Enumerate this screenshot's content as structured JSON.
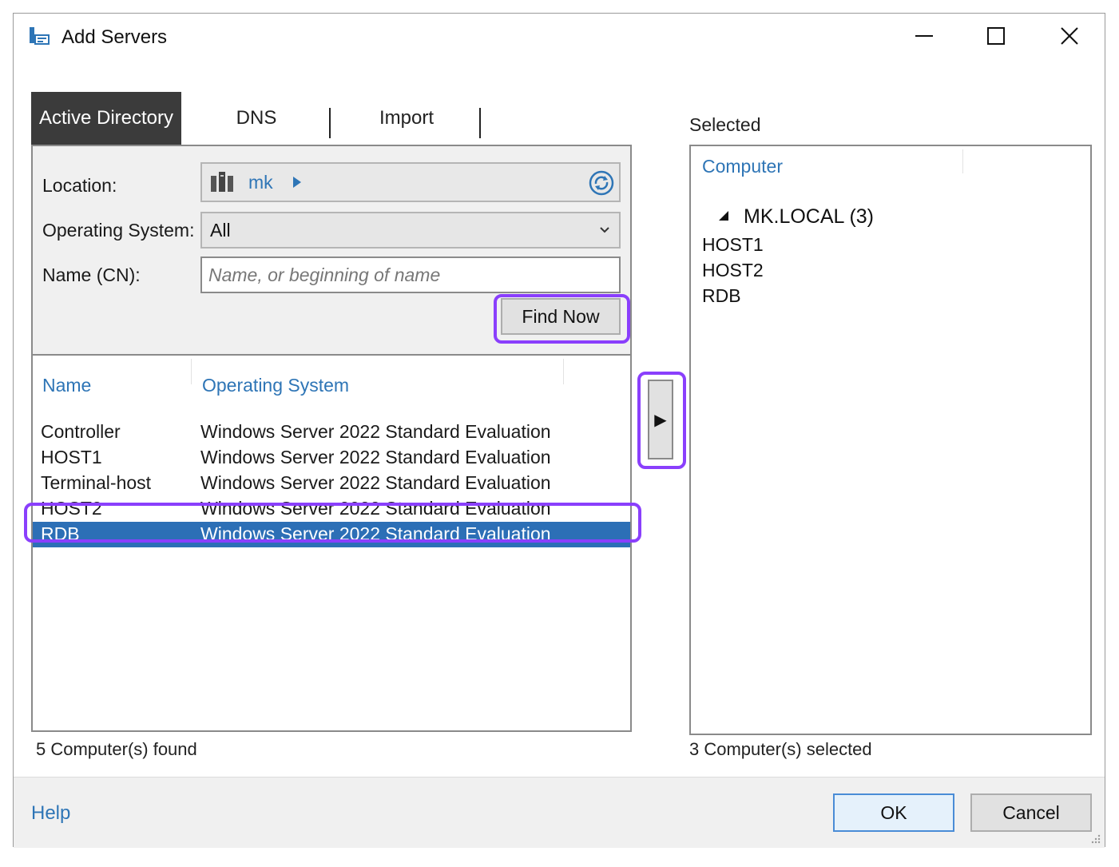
{
  "window": {
    "title": "Add Servers",
    "controls": {
      "minimize": "minimize",
      "maximize": "maximize",
      "close": "close"
    }
  },
  "tabs": [
    {
      "label": "Active Directory",
      "active": true
    },
    {
      "label": "DNS",
      "active": false
    },
    {
      "label": "Import",
      "active": false
    }
  ],
  "search": {
    "location_label": "Location:",
    "location_value": "mk",
    "os_label": "Operating System:",
    "os_value": "All",
    "name_label": "Name (CN):",
    "name_placeholder": "Name, or beginning of name",
    "name_value": "",
    "find_now_label": "Find Now"
  },
  "results": {
    "columns": [
      "Name",
      "Operating System"
    ],
    "rows": [
      {
        "name": "Controller",
        "os": "Windows Server 2022 Standard Evaluation",
        "selected": false
      },
      {
        "name": "HOST1",
        "os": "Windows Server 2022 Standard Evaluation",
        "selected": false
      },
      {
        "name": "Terminal-host",
        "os": "Windows Server 2022 Standard Evaluation",
        "selected": false
      },
      {
        "name": "HOST2",
        "os": "Windows Server 2022 Standard Evaluation",
        "selected": false
      },
      {
        "name": "RDB",
        "os": "Windows Server 2022 Standard Evaluation",
        "selected": true
      }
    ],
    "status": "5 Computer(s) found"
  },
  "add_button_label": "▶",
  "selected": {
    "title": "Selected",
    "column": "Computer",
    "group_label": "MK.LOCAL (3)",
    "items": [
      "HOST1",
      "HOST2",
      "RDB"
    ],
    "status": "3 Computer(s) selected"
  },
  "footer": {
    "help_label": "Help",
    "ok_label": "OK",
    "cancel_label": "Cancel"
  },
  "colors": {
    "accent_blue": "#2e75b6",
    "selection": "#2c6fb6",
    "annotation_highlight": "#8a3ffc",
    "active_tab": "#3b3b3b"
  },
  "icons": {
    "app": "server-manager-icon",
    "location": "server-tower-icon",
    "refresh": "refresh-icon",
    "dropdown": "chevron-down-icon",
    "tree_expand": "triangle-expanded-icon"
  }
}
